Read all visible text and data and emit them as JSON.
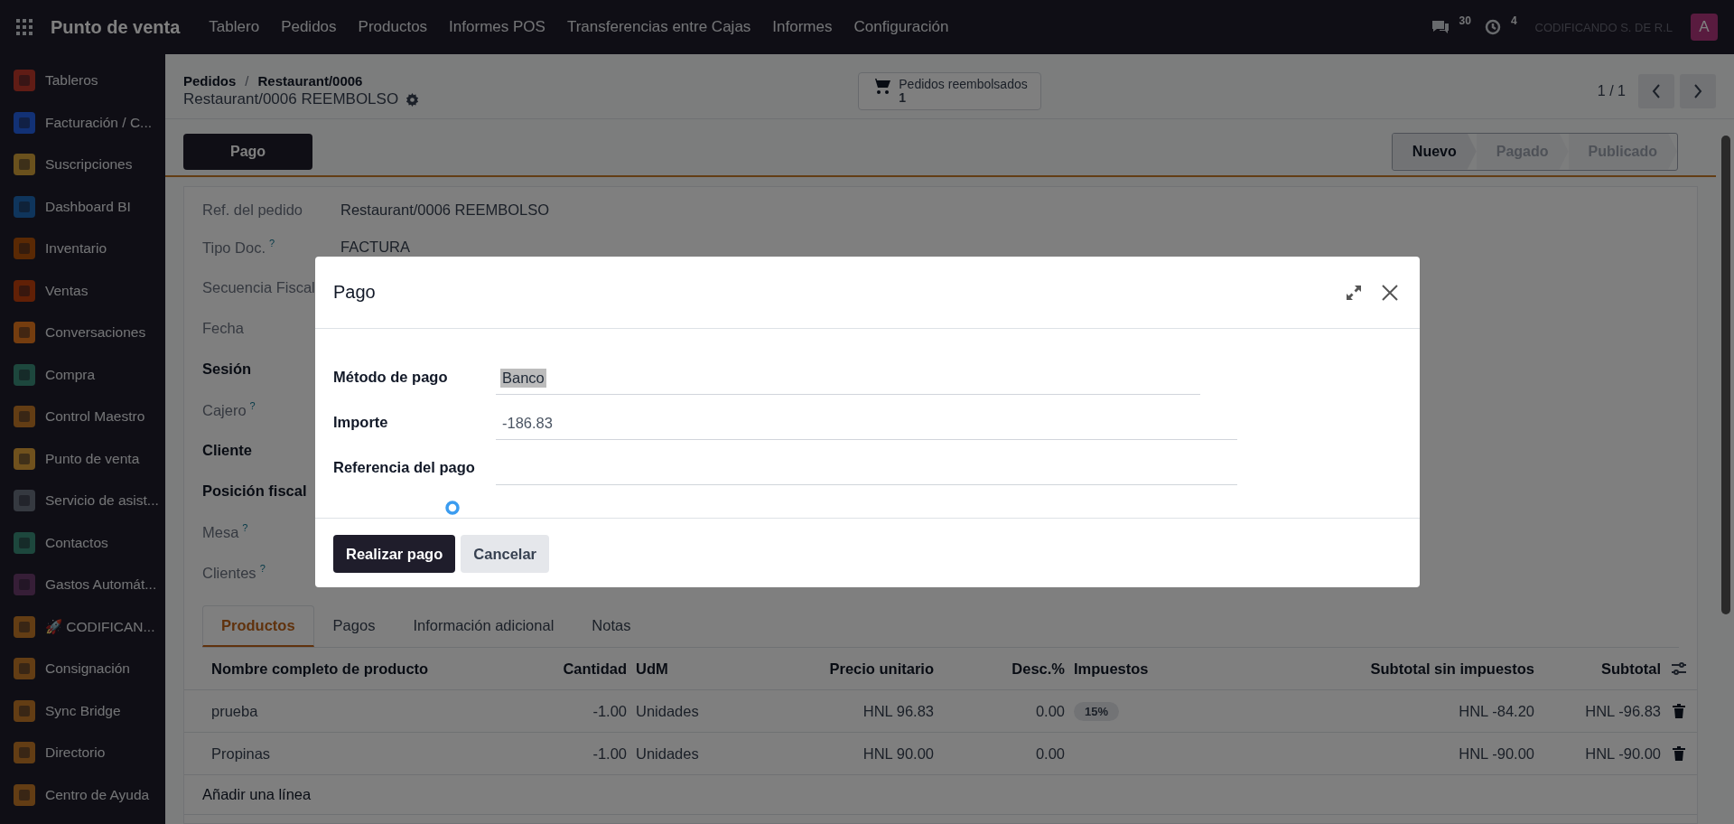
{
  "navbar": {
    "app_name": "Punto de venta",
    "menu": [
      "Tablero",
      "Pedidos",
      "Productos",
      "Informes POS",
      "Transferencias entre Cajas",
      "Informes",
      "Configuración"
    ],
    "messages_count": "30",
    "activities_count": "4",
    "company": "CODIFICANDO S. DE R.L",
    "avatar": "A"
  },
  "sidebar": {
    "items": [
      {
        "label": "Tableros"
      },
      {
        "label": "Facturación / C..."
      },
      {
        "label": "Suscripciones"
      },
      {
        "label": "Dashboard BI"
      },
      {
        "label": "Inventario"
      },
      {
        "label": "Ventas"
      },
      {
        "label": "Conversaciones"
      },
      {
        "label": "Compra"
      },
      {
        "label": "Control Maestro"
      },
      {
        "label": "Punto de venta"
      },
      {
        "label": "Servicio de asist..."
      },
      {
        "label": "Contactos"
      },
      {
        "label": "Gastos Automát..."
      },
      {
        "label": "🚀 CODIFICAN..."
      },
      {
        "label": "Consignación"
      },
      {
        "label": "Sync Bridge"
      },
      {
        "label": "Directorio"
      },
      {
        "label": "Centro de Ayuda"
      }
    ]
  },
  "breadcrumb": {
    "parent": "Pedidos",
    "separator": "/",
    "current": "Restaurant/0006",
    "record_title": "Restaurant/0006 REEMBOLSO"
  },
  "smart_button": {
    "label": "Pedidos reembolsados",
    "count": "1"
  },
  "pager": {
    "value": "1 / 1"
  },
  "action_buttons": [
    "Pago"
  ],
  "status_steps": [
    {
      "label": "Nuevo",
      "selected": true
    },
    {
      "label": "Pagado",
      "selected": false
    },
    {
      "label": "Publicado",
      "selected": false
    }
  ],
  "form_fields": [
    {
      "label": "Ref. del pedido",
      "emphasized": false,
      "value": "Restaurant/0006 REEMBOLSO"
    },
    {
      "label": "Tipo Doc.",
      "emphasized": false,
      "help": "?",
      "value": "FACTURA"
    },
    {
      "label": "Secuencia Fiscal",
      "emphasized": false
    },
    {
      "label": "Fecha",
      "emphasized": false
    },
    {
      "label": "Sesión",
      "emphasized": true
    },
    {
      "label": "Cajero",
      "emphasized": false,
      "help": "?"
    },
    {
      "label": "Cliente",
      "emphasized": true
    },
    {
      "label": "Posición fiscal",
      "emphasized": true
    },
    {
      "label": "Mesa",
      "emphasized": false,
      "help": "?"
    },
    {
      "label": "Clientes",
      "emphasized": false,
      "help": "?"
    }
  ],
  "tabs": [
    {
      "label": "Productos",
      "selected": true
    },
    {
      "label": "Pagos",
      "selected": false
    },
    {
      "label": "Información adicional",
      "selected": false
    },
    {
      "label": "Notas",
      "selected": false
    }
  ],
  "table": {
    "columns": [
      "Nombre completo de producto",
      "Cantidad",
      "UdM",
      "Precio unitario",
      "Desc.%",
      "Impuestos",
      "Subtotal sin impuestos",
      "Subtotal"
    ],
    "rows": [
      {
        "product": "prueba",
        "quantity": "-1.00",
        "uom": "Unidades",
        "price": "HNL 96.83",
        "discount": "0.00",
        "taxes": [
          "15%"
        ],
        "subtotal_excl": "HNL -84.20",
        "subtotal": "HNL -96.83"
      },
      {
        "product": "Propinas",
        "quantity": "-1.00",
        "uom": "Unidades",
        "price": "HNL 90.00",
        "discount": "0.00",
        "taxes": [],
        "subtotal_excl": "HNL -90.00",
        "subtotal": "HNL -90.00"
      }
    ],
    "add_line": "Añadir una línea"
  },
  "dialog": {
    "title": "Pago",
    "fields": [
      {
        "label": "Método de pago",
        "value": "Banco",
        "highlighted": true
      },
      {
        "label": "Importe",
        "value": "-186.83"
      },
      {
        "label": "Referencia del pago"
      }
    ],
    "buttons": [
      {
        "label": "Realizar pago",
        "kind": "primary"
      },
      {
        "label": "Cancelar",
        "kind": "secondary"
      }
    ]
  }
}
